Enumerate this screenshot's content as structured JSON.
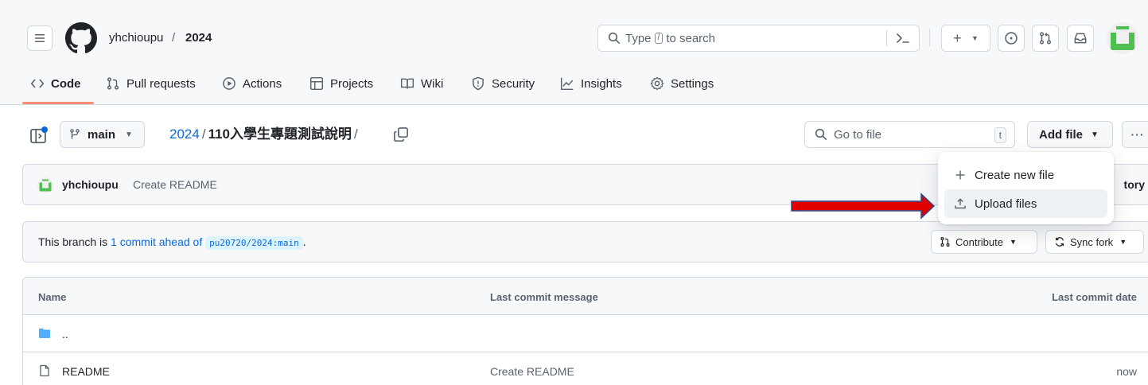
{
  "header": {
    "owner": "yhchioupu",
    "separator": "/",
    "repo": "2024",
    "search_prefix": "Type",
    "search_key": "/",
    "search_suffix": "to search",
    "plus_label": "+"
  },
  "nav": {
    "tabs": [
      {
        "label": "Code",
        "icon": "code-icon",
        "active": true
      },
      {
        "label": "Pull requests",
        "icon": "git-pull-request-icon"
      },
      {
        "label": "Actions",
        "icon": "play-icon"
      },
      {
        "label": "Projects",
        "icon": "table-icon"
      },
      {
        "label": "Wiki",
        "icon": "book-icon"
      },
      {
        "label": "Security",
        "icon": "shield-icon"
      },
      {
        "label": "Insights",
        "icon": "graph-icon"
      },
      {
        "label": "Settings",
        "icon": "gear-icon"
      }
    ]
  },
  "pathbar": {
    "branch": "main",
    "path_root": "2024",
    "path_sep": "/",
    "path_current": "110入學生專題測試說明",
    "path_trailing": "/",
    "goto_placeholder": "Go to file",
    "goto_key": "t",
    "add_file_label": "Add file",
    "more_label": "···"
  },
  "commit": {
    "author": "yhchioupu",
    "message": "Create README",
    "history_tail": "tory"
  },
  "branch_info": {
    "prefix": "This branch is",
    "ahead_link": "1 commit ahead of",
    "upstream_ref": "pu20720/2024:main",
    "suffix": ".",
    "contribute_label": "Contribute",
    "sync_label": "Sync fork"
  },
  "files": {
    "columns": {
      "name": "Name",
      "message": "Last commit message",
      "date": "Last commit date"
    },
    "rows": [
      {
        "name": "..",
        "type": "folder",
        "message": "",
        "date": ""
      },
      {
        "name": "README",
        "type": "file",
        "message": "Create README",
        "date": "now"
      }
    ]
  },
  "dropdown": {
    "create_label": "Create new file",
    "upload_label": "Upload files"
  },
  "colors": {
    "accent_link": "#0969da",
    "active_tab_underline": "#fd8c73",
    "annotation_arrow": "#e00000",
    "annotation_outline": "#2f4b8c"
  }
}
